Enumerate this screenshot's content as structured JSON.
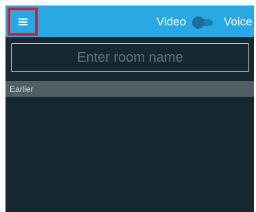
{
  "toolbar": {
    "video_label": "Video",
    "voice_label": "Voice",
    "menu_icon": "hamburger-menu-icon",
    "accent_color": "#28A9E3",
    "highlight_color": "#e01b24"
  },
  "call_mode_toggle": {
    "state": "video"
  },
  "room_input": {
    "value": "",
    "placeholder": "Enter room name"
  },
  "history": {
    "section_label": "Earlier",
    "items": []
  }
}
